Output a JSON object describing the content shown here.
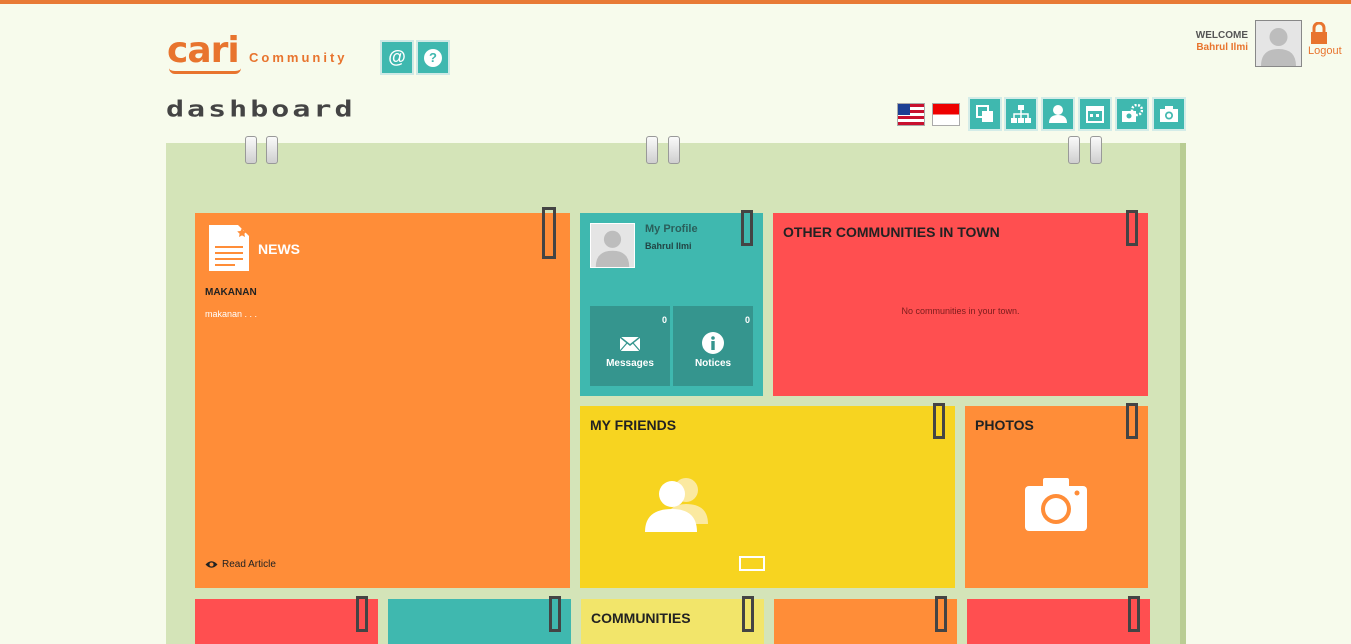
{
  "header": {
    "logo_brand": "cari",
    "logo_word": "Community",
    "mention_label": "@",
    "help_label": "?",
    "welcome_label": "WELCOME",
    "user_name": "Bahrul Ilmi",
    "logout_label": "Logout"
  },
  "page": {
    "title": "dashboard"
  },
  "tiles": {
    "news": {
      "title": "NEWS",
      "headline": "MAKANAN",
      "excerpt": "makanan . . .",
      "read_label": "Read Article"
    },
    "profile": {
      "title": "My Profile",
      "name": "Bahrul Ilmi",
      "messages_label": "Messages",
      "messages_count": "0",
      "notices_label": "Notices",
      "notices_count": "0"
    },
    "other": {
      "title": "OTHER COMMUNITIES IN TOWN",
      "empty_text": "No communities in your town."
    },
    "friends": {
      "title": "MY FRIENDS"
    },
    "photos": {
      "title": "PHOTOS"
    },
    "communities": {
      "title": "COMMUNITIES"
    }
  },
  "colors": {
    "accent": "#e8742e",
    "teal": "#3fb8af",
    "orange": "#ff8d38",
    "red": "#ff4f50",
    "yellow": "#f7d420",
    "board": "#d4e4b8"
  }
}
